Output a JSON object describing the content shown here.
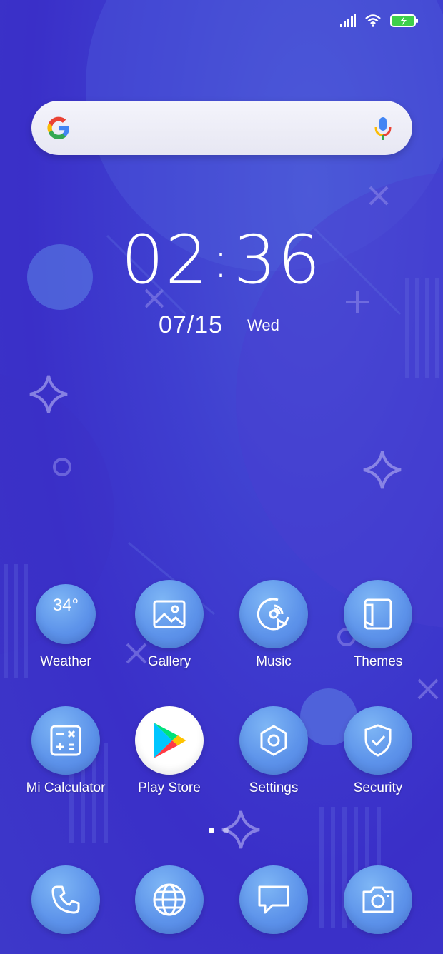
{
  "status_bar": {
    "signal_icon": "signal-icon",
    "wifi_icon": "wifi-icon",
    "battery_icon": "battery-charging-icon"
  },
  "search": {
    "logo_icon": "google-g-icon",
    "mic_icon": "mic-icon"
  },
  "clock": {
    "hours": "02",
    "minutes": "36",
    "date": "07/15",
    "day": "Wed"
  },
  "apps": [
    {
      "label": "Weather",
      "icon": "weather-icon",
      "temp": "34°"
    },
    {
      "label": "Gallery",
      "icon": "gallery-icon"
    },
    {
      "label": "Music",
      "icon": "music-icon"
    },
    {
      "label": "Themes",
      "icon": "themes-icon"
    },
    {
      "label": "Mi Calculator",
      "icon": "calculator-icon"
    },
    {
      "label": "Play Store",
      "icon": "play-store-icon"
    },
    {
      "label": "Settings",
      "icon": "settings-icon"
    },
    {
      "label": "Security",
      "icon": "security-icon"
    }
  ],
  "page_indicator": {
    "current": 1,
    "total": 2
  },
  "dock": [
    {
      "icon": "phone-icon"
    },
    {
      "icon": "browser-icon"
    },
    {
      "icon": "messages-icon"
    },
    {
      "icon": "camera-icon"
    }
  ],
  "colors": {
    "background": "#3d38c9",
    "icon_blue": "#5d93ea",
    "battery_green": "#3ecf4a"
  }
}
